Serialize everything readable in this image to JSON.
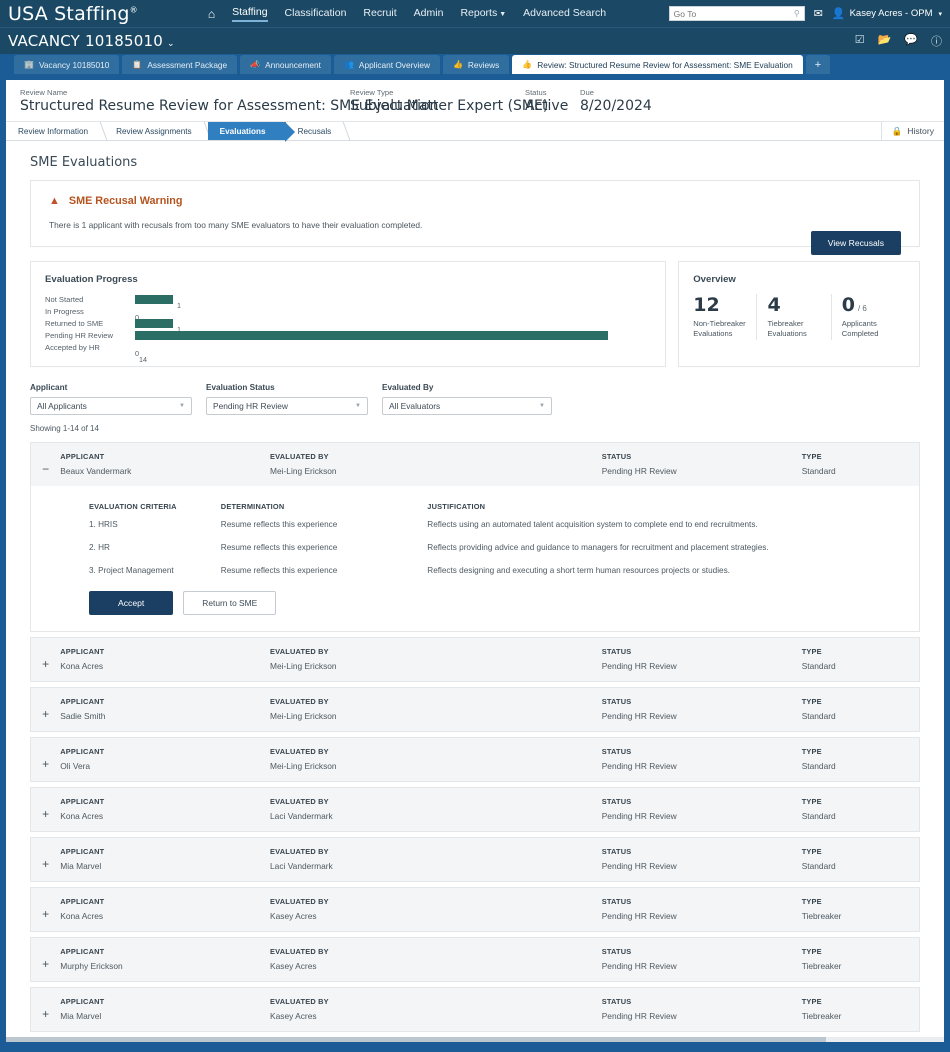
{
  "topnav": {
    "brand": "USA Staffing",
    "brand_sup": "®",
    "home_icon": "home-icon",
    "links": [
      {
        "label": "Staffing",
        "active": true,
        "caret": false
      },
      {
        "label": "Classification",
        "active": false,
        "caret": false
      },
      {
        "label": "Recruit",
        "active": false,
        "caret": false
      },
      {
        "label": "Admin",
        "active": false,
        "caret": false
      },
      {
        "label": "Reports",
        "active": false,
        "caret": true
      },
      {
        "label": "Advanced Search",
        "active": false,
        "caret": false
      }
    ],
    "search_placeholder": "Go To",
    "search_value": "",
    "search_icon": "search-icon",
    "mail_icon": "envelope-icon",
    "user_icon": "user-avatar-icon",
    "user_name": "Kasey Acres - OPM",
    "user_caret": "▾"
  },
  "vacancy_bar": {
    "title": "VACANCY 10185010",
    "caret": "⌄",
    "icons": [
      "tasks-icon",
      "folder-icon",
      "comment-icon",
      "help-icon"
    ]
  },
  "tabs": [
    {
      "label": "Vacancy 10185010",
      "icon": "building-icon",
      "active": false
    },
    {
      "label": "Assessment Package",
      "icon": "copy-icon",
      "active": false
    },
    {
      "label": "Announcement",
      "icon": "megaphone-icon",
      "active": false
    },
    {
      "label": "Applicant Overview",
      "icon": "people-icon",
      "active": false
    },
    {
      "label": "Reviews",
      "icon": "thumbsup-icon",
      "active": false
    },
    {
      "label": "Review: Structured Resume Review for Assessment: SME Evaluation",
      "icon": "thumbsup-icon",
      "active": true
    }
  ],
  "tab_add_label": "+",
  "review_header": {
    "name_label": "Review Name",
    "name_value": "Structured Resume Review for Assessment: SME Evaluation",
    "type_label": "Review Type",
    "type_value": "Subject Matter Expert (SME)",
    "status_label": "Status",
    "status_value": "Active",
    "due_label": "Due",
    "due_value": "8/20/2024"
  },
  "breadcrumb": {
    "items": [
      {
        "label": "Review Information",
        "active": false
      },
      {
        "label": "Review Assignments",
        "active": false
      },
      {
        "label": "Evaluations",
        "active": true
      },
      {
        "label": "Recusals",
        "active": false
      }
    ],
    "history_label": "History",
    "history_icon": "lock-icon"
  },
  "page_title": "SME Evaluations",
  "warning": {
    "icon": "warning-triangle-icon",
    "title": "SME Recusal Warning",
    "text": "There is 1 applicant with recusals from too many SME evaluators to have their evaluation completed.",
    "button_label": "View Recusals"
  },
  "chart_data": {
    "type": "bar",
    "title": "Evaluation Progress",
    "orientation": "horizontal",
    "categories": [
      "Not Started",
      "In Progress",
      "Returned to SME",
      "Pending HR Review",
      "Accepted by HR"
    ],
    "values": [
      1,
      0,
      1,
      14,
      0
    ],
    "bar_color": "#2b6e66",
    "xlabel": "",
    "ylabel": "",
    "xlim": [
      0,
      14
    ],
    "grid": false,
    "legend": false,
    "data_labels": [
      "1",
      "0",
      "1",
      "14",
      "0"
    ]
  },
  "overview": {
    "title": "Overview",
    "stats": [
      {
        "value": "12",
        "suffix": "",
        "caption": "Non-Tiebreaker Evaluations"
      },
      {
        "value": "4",
        "suffix": "",
        "caption": "Tiebreaker Evaluations"
      },
      {
        "value": "0",
        "suffix": "/ 6",
        "caption": "Applicants Completed"
      }
    ]
  },
  "filters": [
    {
      "label": "Applicant",
      "value": "All Applicants"
    },
    {
      "label": "Evaluation Status",
      "value": "Pending HR Review"
    },
    {
      "label": "Evaluated By",
      "value": "All Evaluators"
    }
  ],
  "showing_text": "Showing 1-14 of 14",
  "column_headers": {
    "applicant": "APPLICANT",
    "evaluated_by": "EVALUATED BY",
    "status": "STATUS",
    "type": "TYPE"
  },
  "criteria_headers": {
    "criteria": "EVALUATION CRITERIA",
    "determination": "DETERMINATION",
    "justification": "JUSTIFICATION"
  },
  "expanded_row": {
    "toggle": "−",
    "applicant": "Beaux Vandermark",
    "evaluated_by": "Mei-Ling Erickson",
    "status": "Pending HR Review",
    "type": "Standard",
    "criteria": [
      {
        "name": "1. HRIS",
        "determination": "Resume reflects this experience",
        "justification": "Reflects using an automated talent acquisition system to complete end to end recruitments."
      },
      {
        "name": "2. HR",
        "determination": "Resume reflects this experience",
        "justification": "Reflects providing advice and guidance to managers for recruitment and placement strategies."
      },
      {
        "name": "3. Project Management",
        "determination": "Resume reflects this experience",
        "justification": "Reflects designing and executing a short term human resources projects or studies."
      }
    ],
    "accept_label": "Accept",
    "return_label": "Return to SME"
  },
  "collapsed_rows": [
    {
      "toggle": "+",
      "applicant": "Kona Acres",
      "evaluated_by": "Mei-Ling Erickson",
      "status": "Pending HR Review",
      "type": "Standard"
    },
    {
      "toggle": "+",
      "applicant": "Sadie Smith",
      "evaluated_by": "Mei-Ling Erickson",
      "status": "Pending HR Review",
      "type": "Standard"
    },
    {
      "toggle": "+",
      "applicant": "Oli Vera",
      "evaluated_by": "Mei-Ling Erickson",
      "status": "Pending HR Review",
      "type": "Standard"
    },
    {
      "toggle": "+",
      "applicant": "Kona Acres",
      "evaluated_by": "Laci Vandermark",
      "status": "Pending HR Review",
      "type": "Standard"
    },
    {
      "toggle": "+",
      "applicant": "Mia Marvel",
      "evaluated_by": "Laci Vandermark",
      "status": "Pending HR Review",
      "type": "Standard"
    },
    {
      "toggle": "+",
      "applicant": "Kona Acres",
      "evaluated_by": "Kasey Acres",
      "status": "Pending HR Review",
      "type": "Tiebreaker"
    },
    {
      "toggle": "+",
      "applicant": "Murphy Erickson",
      "evaluated_by": "Kasey Acres",
      "status": "Pending HR Review",
      "type": "Tiebreaker"
    },
    {
      "toggle": "+",
      "applicant": "Mia Marvel",
      "evaluated_by": "Kasey Acres",
      "status": "Pending HR Review",
      "type": "Tiebreaker"
    }
  ]
}
